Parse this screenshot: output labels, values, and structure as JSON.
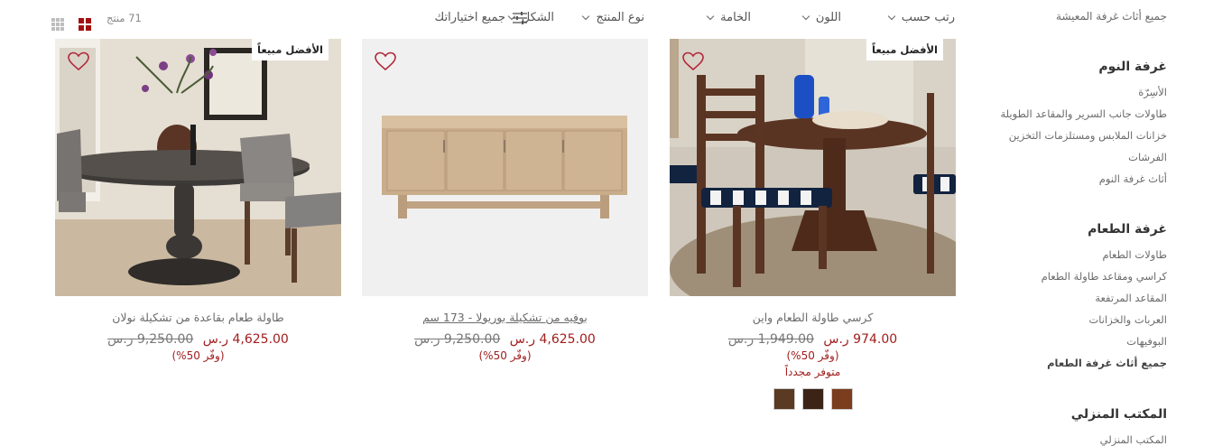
{
  "toolbar": {
    "sort_label": "رتب حسب",
    "filters": [
      "اللون",
      "الخامة",
      "نوع المنتج",
      "الشكل"
    ],
    "all_filters_label": "جميع اختياراتك",
    "count_label": "71 منتج"
  },
  "sidebar": {
    "top_link": "جميع أثاث غرفة المعيشة",
    "groups": [
      {
        "title": "غرفة النوم",
        "items": [
          "الأسِرّة",
          "طاولات جانب السرير والمقاعد الطويلة",
          "خزانات الملابس ومستلزمات التخزين",
          "الفرشات",
          "أثاث غرفة النوم"
        ]
      },
      {
        "title": "غرفة الطعام",
        "items": [
          "طاولات الطعام",
          "كراسي ومقاعد طاولة الطعام",
          "المقاعد المرتفعة",
          "العربات والخزانات",
          "البوفيهات",
          "جميع أثاث غرفة الطعام"
        ]
      },
      {
        "title": "المكتب المنزلي",
        "items": [
          "المكتب المنزلي"
        ]
      }
    ]
  },
  "products": [
    {
      "badge": "الأفضل مبيعاً",
      "title": "كرسي طاولة الطعام واين",
      "price_new": "974.00 ر.س",
      "price_old": "1,949.00 ر.س",
      "save": "(وفّر 50%)",
      "stock": "متوفر مجدداً",
      "swatch_colors": [
        "#5a3a22",
        "#3b2416",
        "#7a3d1d"
      ]
    },
    {
      "badge": "",
      "title": "بوفيه من تشكيلة بوريولا - 173 سم",
      "price_new": "4,625.00 ر.س",
      "price_old": "9,250.00 ر.س",
      "save": "(وفّر 50%)"
    },
    {
      "badge": "الأفضل مبيعاً",
      "title": "طاولة طعام بقاعدة من تشكيلة نولان",
      "price_new": "4,625.00 ر.س",
      "price_old": "9,250.00 ر.س",
      "save": "(وفّر 50%)"
    }
  ],
  "colors": {
    "accent": "#a11d1d",
    "heart": "#b0283a"
  }
}
